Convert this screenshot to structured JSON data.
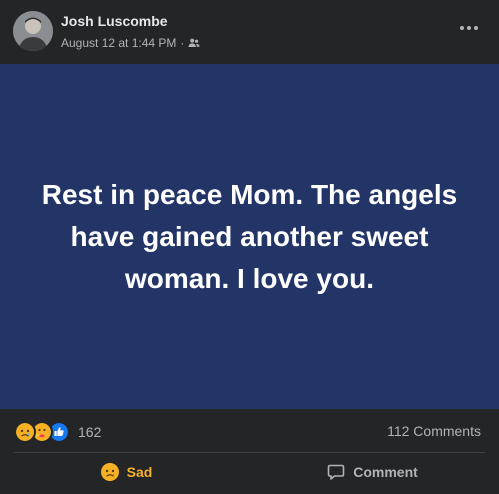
{
  "post": {
    "author": "Josh Luscombe",
    "timestamp": "August 12 at 1:44 PM",
    "separator": "·",
    "audience_icon": "friends-icon",
    "body": "Rest in peace Mom. The angels have gained another sweet woman. I love you.",
    "background_color": "#233466"
  },
  "stats": {
    "reaction_icons": [
      "sad-icon",
      "care-icon",
      "like-icon"
    ],
    "reaction_count": "162",
    "comments": "112 Comments"
  },
  "actions": {
    "reaction_label": "Sad",
    "comment_label": "Comment"
  },
  "colors": {
    "card_bg": "#242526",
    "reaction_accent": "#f7b125",
    "muted_text": "#b0b3b8"
  }
}
